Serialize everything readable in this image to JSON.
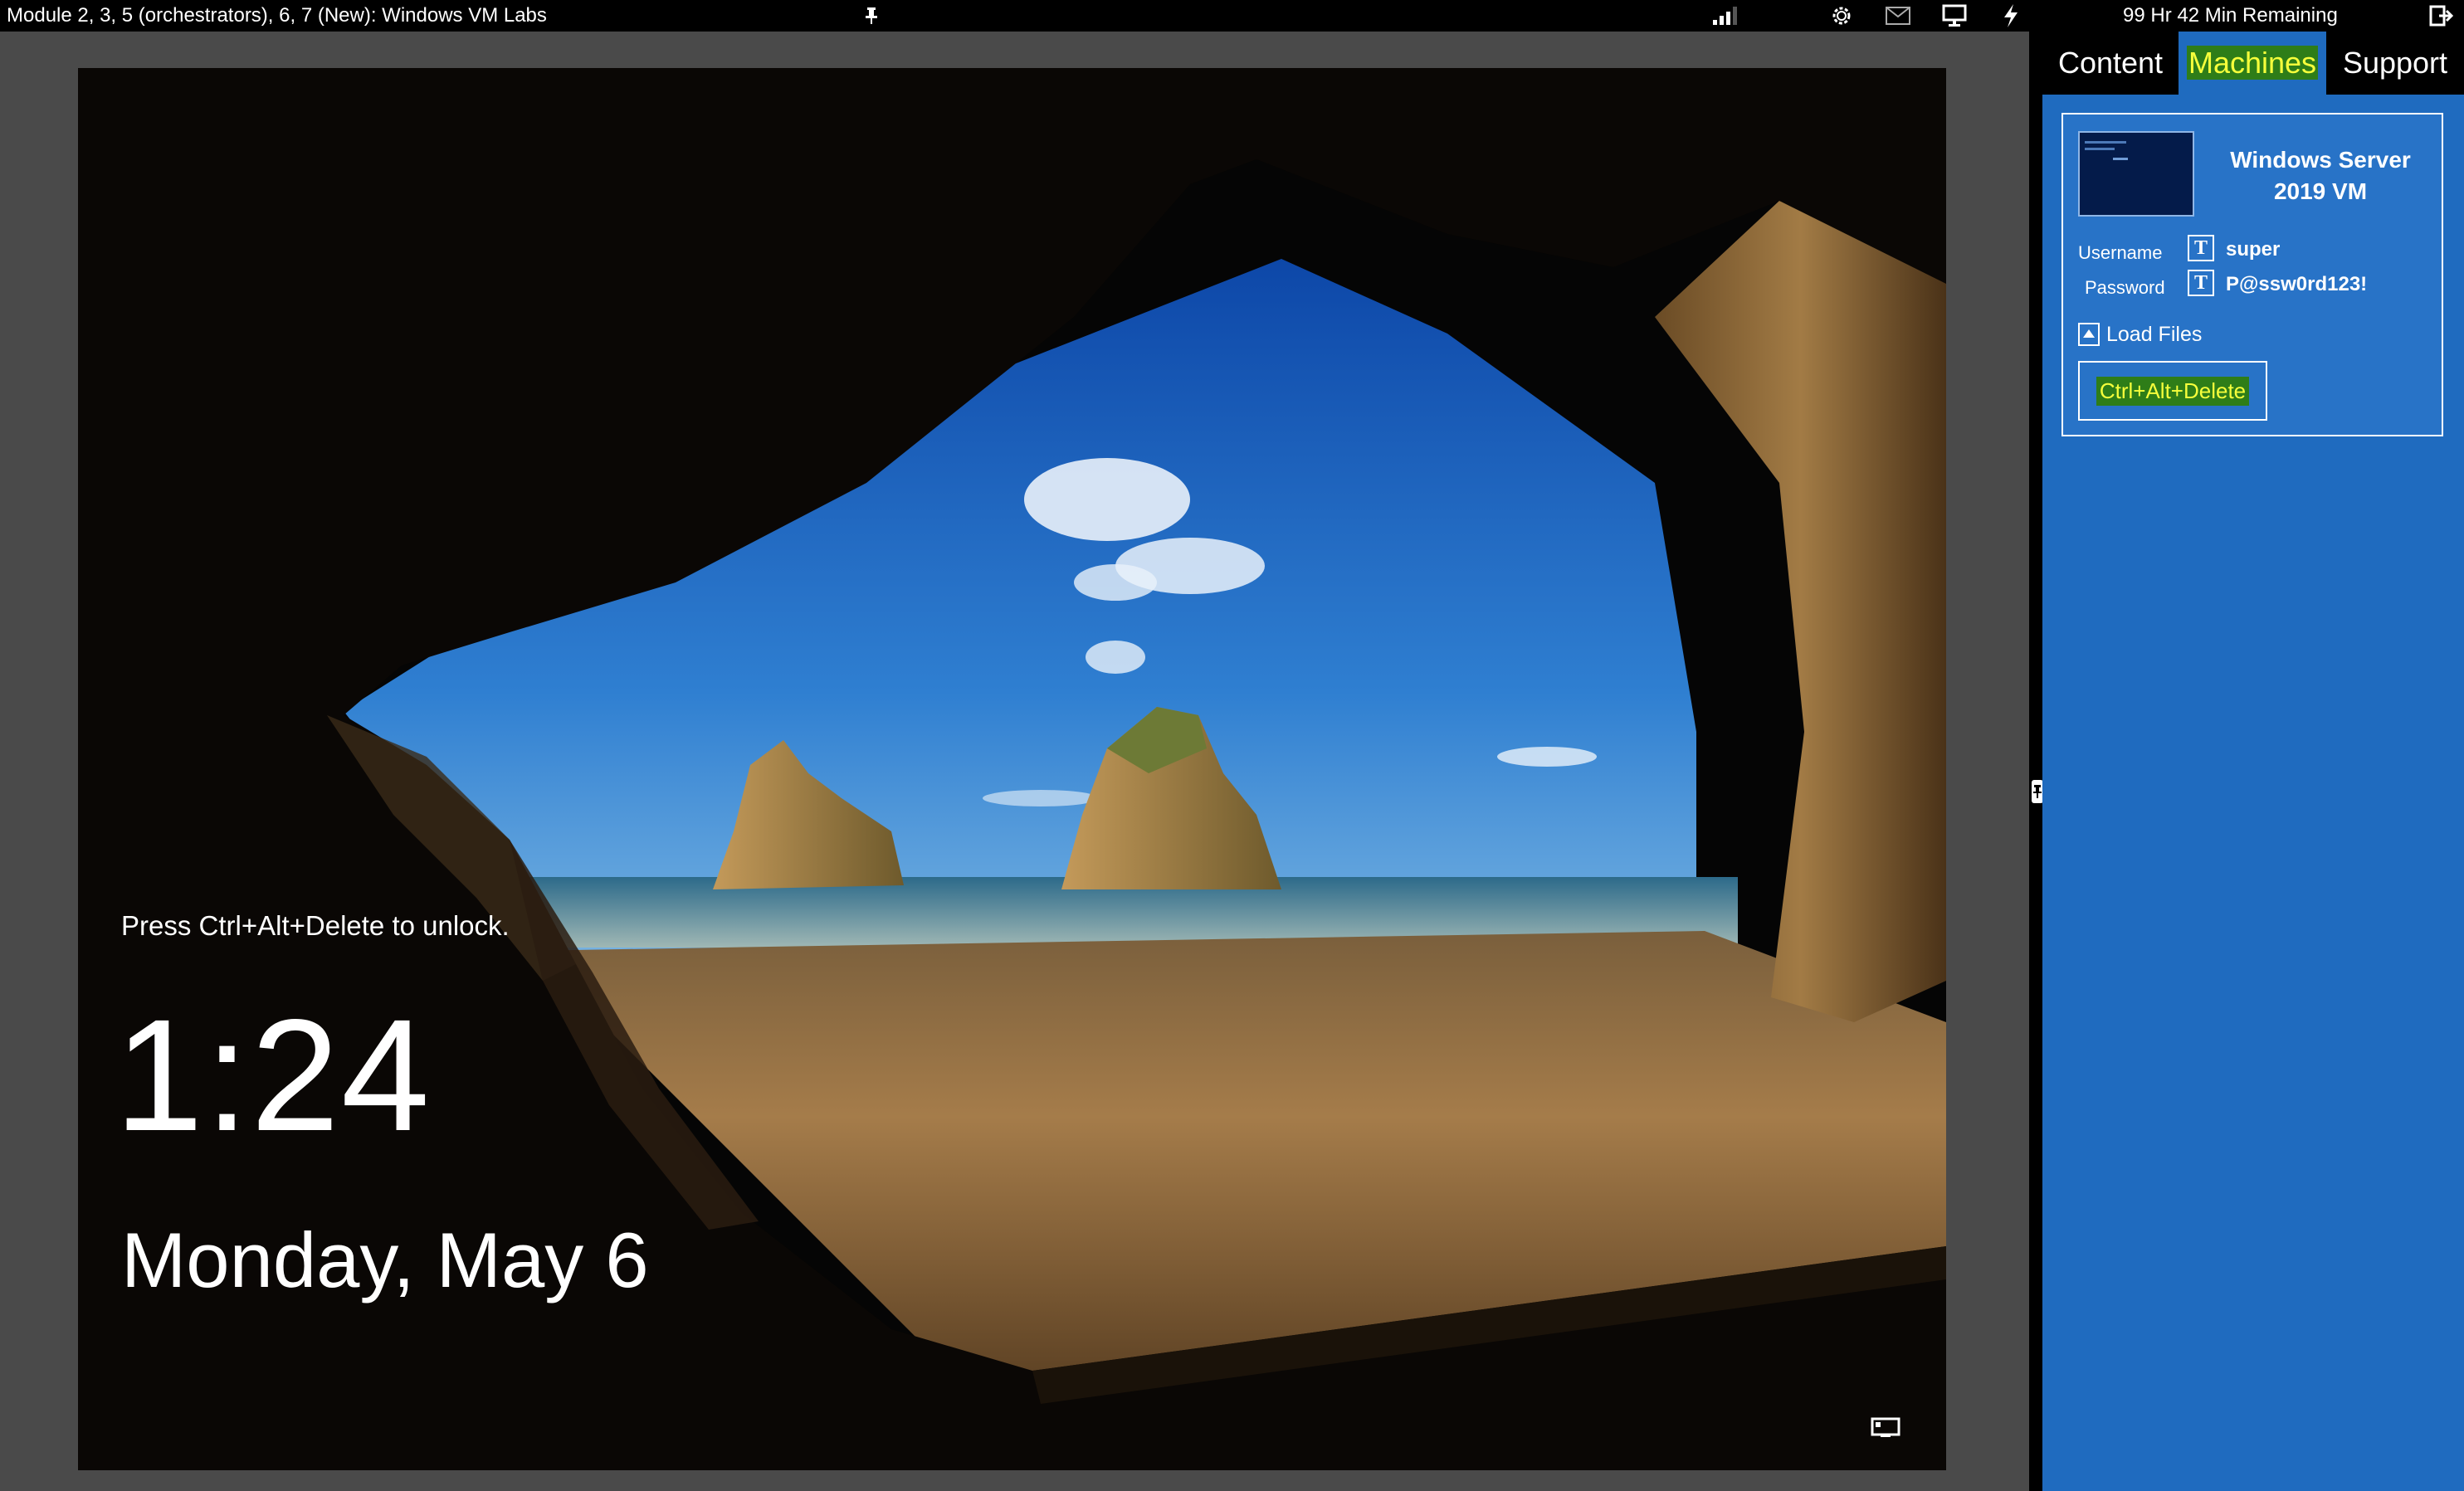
{
  "window": {
    "title": "Module 2, 3, 5 (orchestrators), 6, 7 (New): Windows VM Labs",
    "time_remaining": "99 Hr 42 Min Remaining"
  },
  "toolbar_icons": [
    "pin-icon",
    "signal-strength-icon",
    "settings-gear-icon",
    "mail-icon",
    "monitor-icon",
    "lightning-icon",
    "exit-icon"
  ],
  "lock_screen": {
    "unlock_message": "Press Ctrl+Alt+Delete to unlock.",
    "time": "1:24",
    "date": "Monday, May 6"
  },
  "tabs": [
    {
      "label": "Content"
    },
    {
      "label": "Machines",
      "active": true
    },
    {
      "label": "Support"
    }
  ],
  "machine": {
    "name": "Windows Server 2019 VM",
    "username_label": "Username",
    "username": "super",
    "password_label": "Password",
    "password": "P@ssw0rd123!",
    "type_icon_glyph": "T",
    "load_files_label": "Load Files",
    "cad_label": "Ctrl+Alt+Delete"
  },
  "colors": {
    "panel_blue": "#1f6bbf",
    "highlight_green": "#2e7d18",
    "highlight_yellow": "#f6ff3b",
    "topbar": "#000000"
  }
}
